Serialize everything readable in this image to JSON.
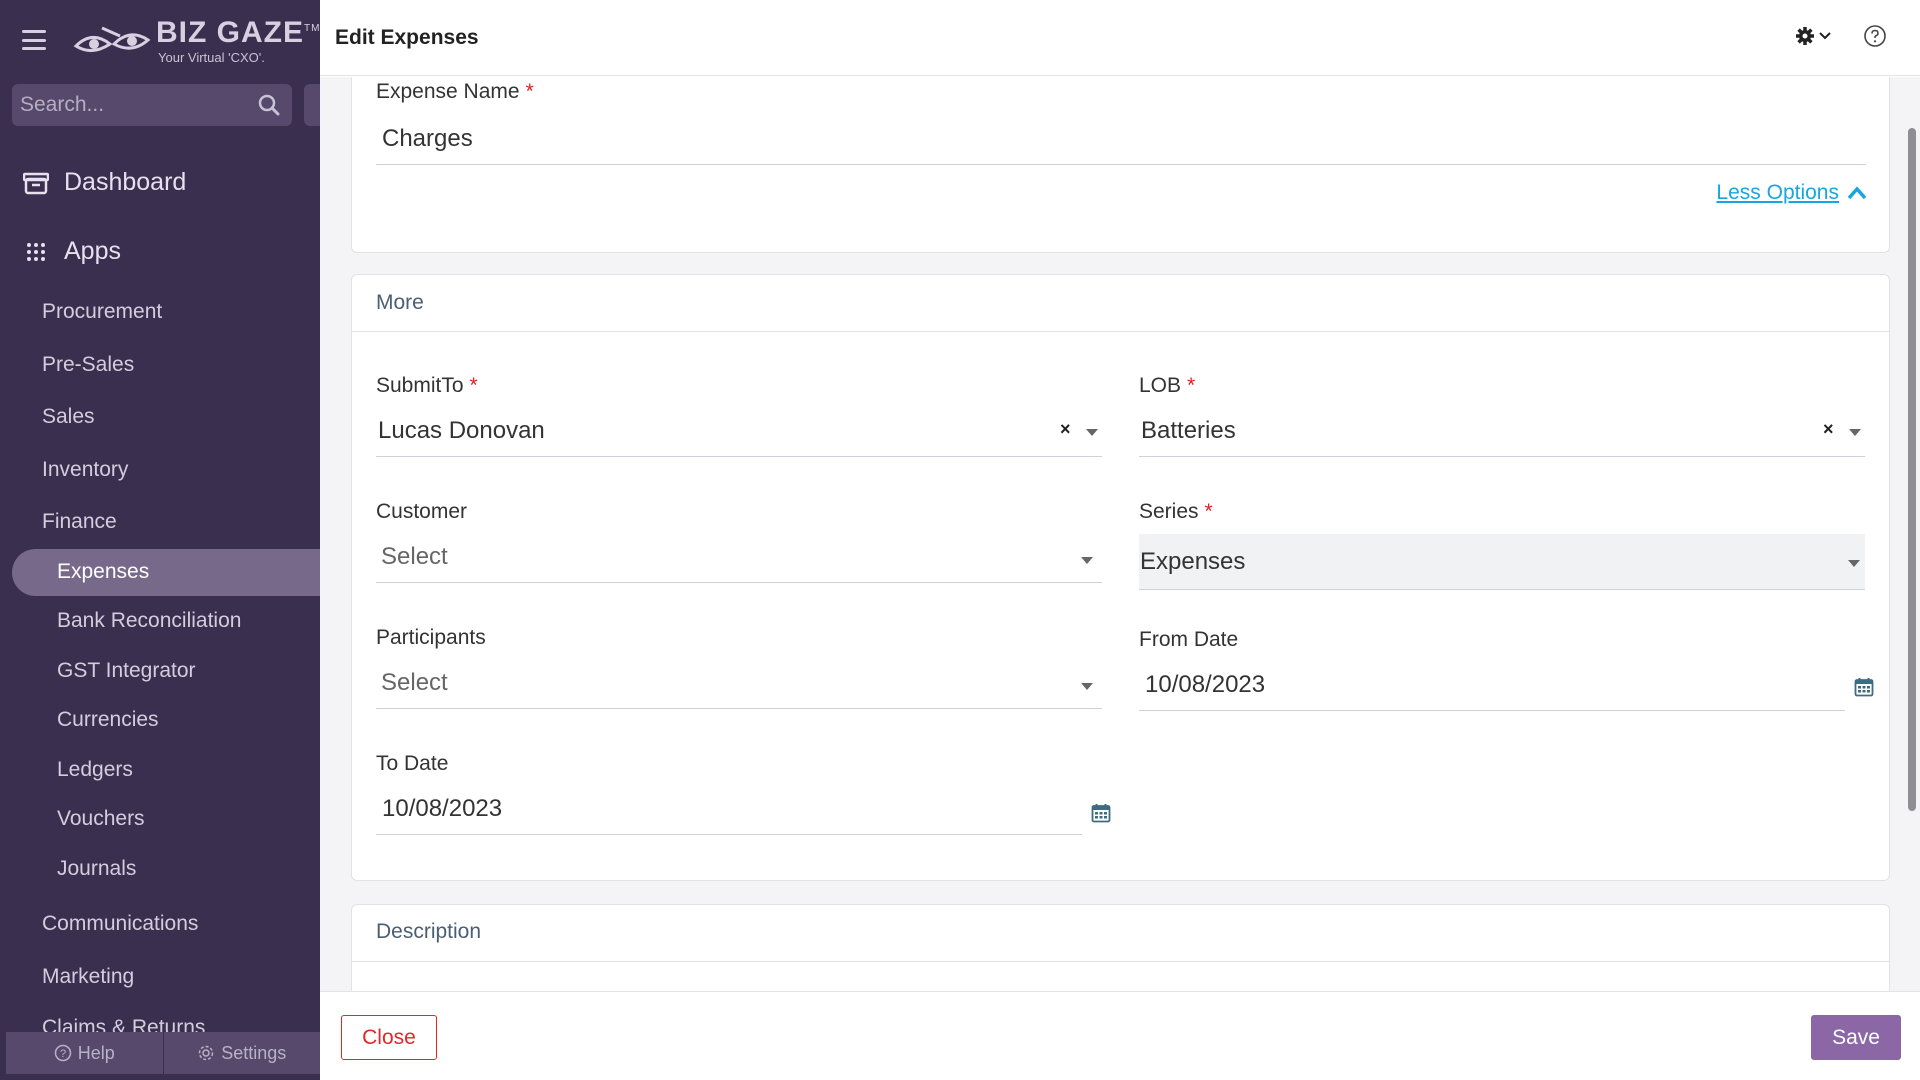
{
  "colors": {
    "sidebar_bg": "#3a2f4f",
    "active_item_bg": "#76698a",
    "accent_link": "#18a6e0",
    "required": "#e02020",
    "close_red": "#e02828",
    "save_purple": "#8b67a6"
  },
  "brand": {
    "name": "BIZ GAZE",
    "trademark": "TM",
    "tagline": "Your Virtual 'CXO'."
  },
  "search": {
    "placeholder": "Search..."
  },
  "sidebar": {
    "dashboard": "Dashboard",
    "apps": "Apps",
    "items": [
      "Procurement",
      "Pre-Sales",
      "Sales",
      "Inventory",
      "Finance"
    ],
    "finance_items": [
      "Expenses",
      "Bank Reconciliation",
      "GST Integrator",
      "Currencies",
      "Ledgers",
      "Vouchers",
      "Journals"
    ],
    "more_items": [
      "Communications",
      "Marketing",
      "Claims & Returns"
    ],
    "active_item": "Expenses",
    "help": "Help",
    "settings": "Settings"
  },
  "header": {
    "title": "Edit Expenses"
  },
  "form": {
    "expense_name": {
      "label": "Expense Name",
      "value": "Charges"
    },
    "less_options": "Less Options",
    "more_section": "More",
    "submit_to": {
      "label": "SubmitTo",
      "value": "Lucas Donovan"
    },
    "lob": {
      "label": "LOB",
      "value": "Batteries"
    },
    "customer": {
      "label": "Customer",
      "placeholder": "Select"
    },
    "series": {
      "label": "Series",
      "value": "Expenses"
    },
    "participants": {
      "label": "Participants",
      "placeholder": "Select"
    },
    "from_date": {
      "label": "From Date",
      "value": "10/08/2023"
    },
    "to_date": {
      "label": "To Date",
      "value": "10/08/2023"
    },
    "description_section": "Description",
    "required_mark": "*",
    "clear_mark": "×"
  },
  "footer": {
    "close": "Close",
    "save": "Save"
  }
}
